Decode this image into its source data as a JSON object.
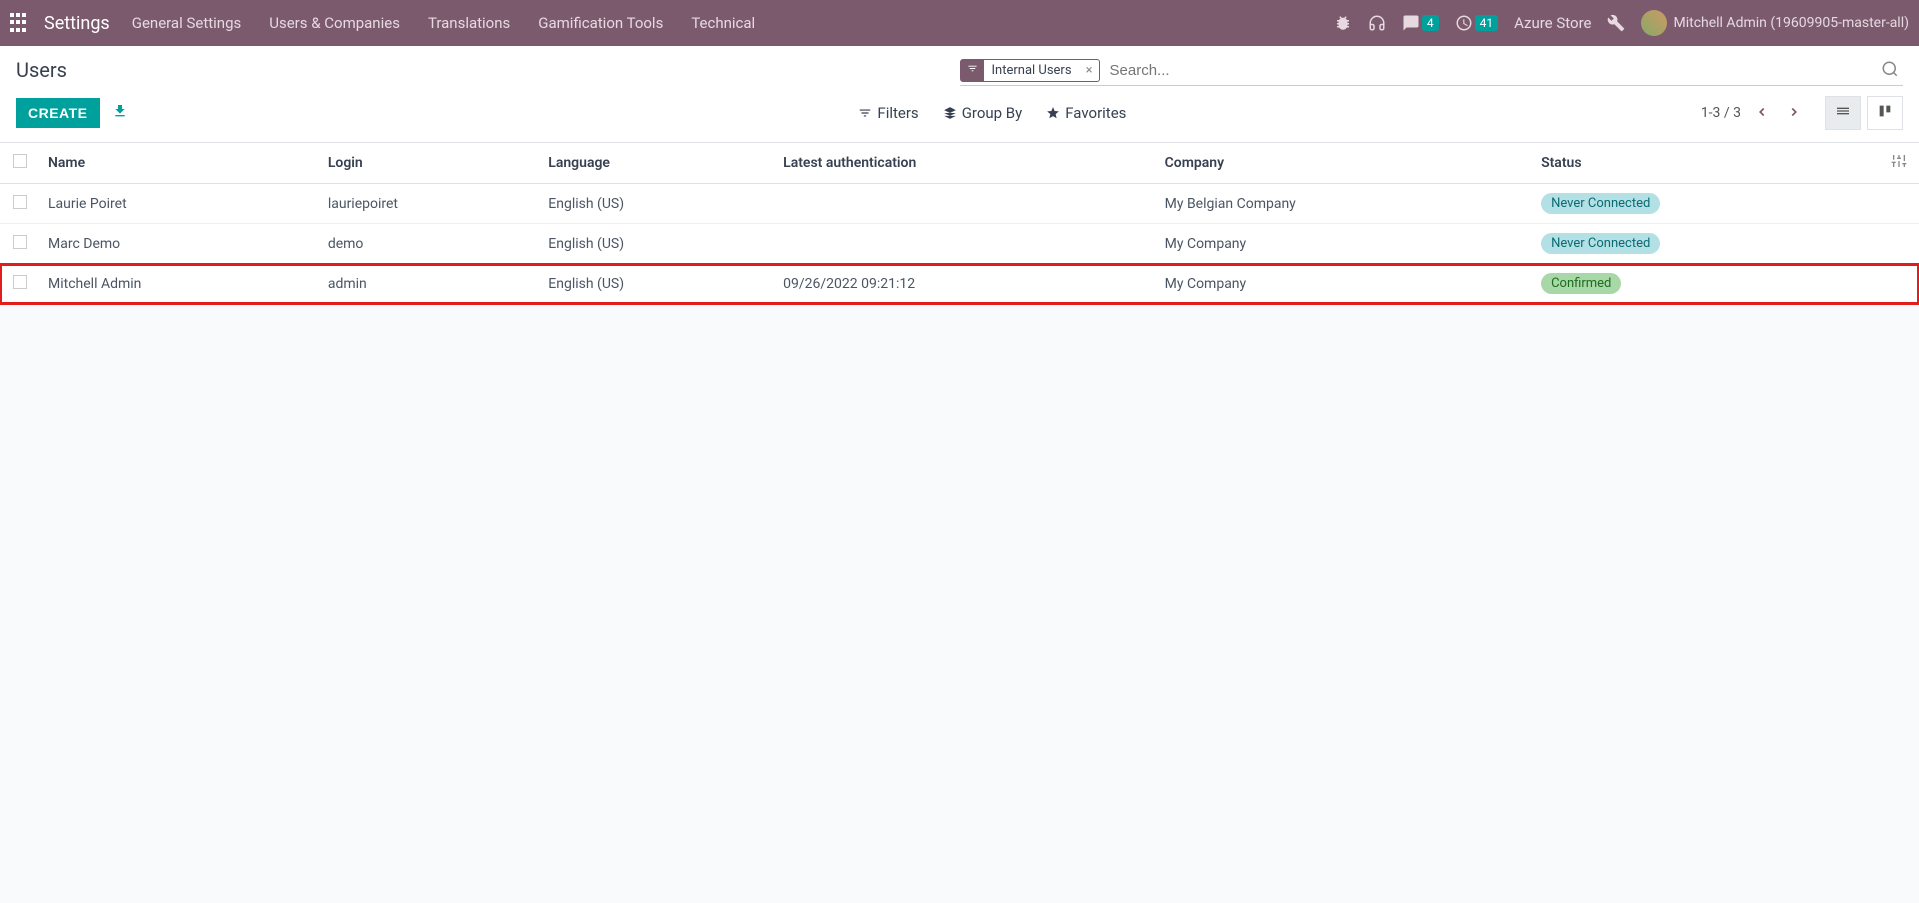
{
  "nav": {
    "brand": "Settings",
    "menu": [
      "General Settings",
      "Users & Companies",
      "Translations",
      "Gamification Tools",
      "Technical"
    ],
    "messages_badge": "4",
    "activities_badge": "41",
    "company": "Azure Store",
    "user": "Mitchell Admin (19609905-master-all)"
  },
  "cp": {
    "title": "Users",
    "filter_facet": "Internal Users",
    "search_placeholder": "Search...",
    "create": "CREATE",
    "filters": "Filters",
    "group_by": "Group By",
    "favorites": "Favorites",
    "pager": "1-3 / 3"
  },
  "columns": {
    "name": "Name",
    "login": "Login",
    "language": "Language",
    "latest_auth": "Latest authentication",
    "company": "Company",
    "status": "Status"
  },
  "rows": [
    {
      "name": "Laurie Poiret",
      "login": "lauriepoiret",
      "language": "English (US)",
      "latest_auth": "",
      "company": "My Belgian Company",
      "status": "Never Connected",
      "status_class": "badge-never",
      "highlight": false
    },
    {
      "name": "Marc Demo",
      "login": "demo",
      "language": "English (US)",
      "latest_auth": "",
      "company": "My Company",
      "status": "Never Connected",
      "status_class": "badge-never",
      "highlight": false
    },
    {
      "name": "Mitchell Admin",
      "login": "admin",
      "language": "English (US)",
      "latest_auth": "09/26/2022 09:21:12",
      "company": "My Company",
      "status": "Confirmed",
      "status_class": "badge-confirmed",
      "highlight": true
    }
  ]
}
